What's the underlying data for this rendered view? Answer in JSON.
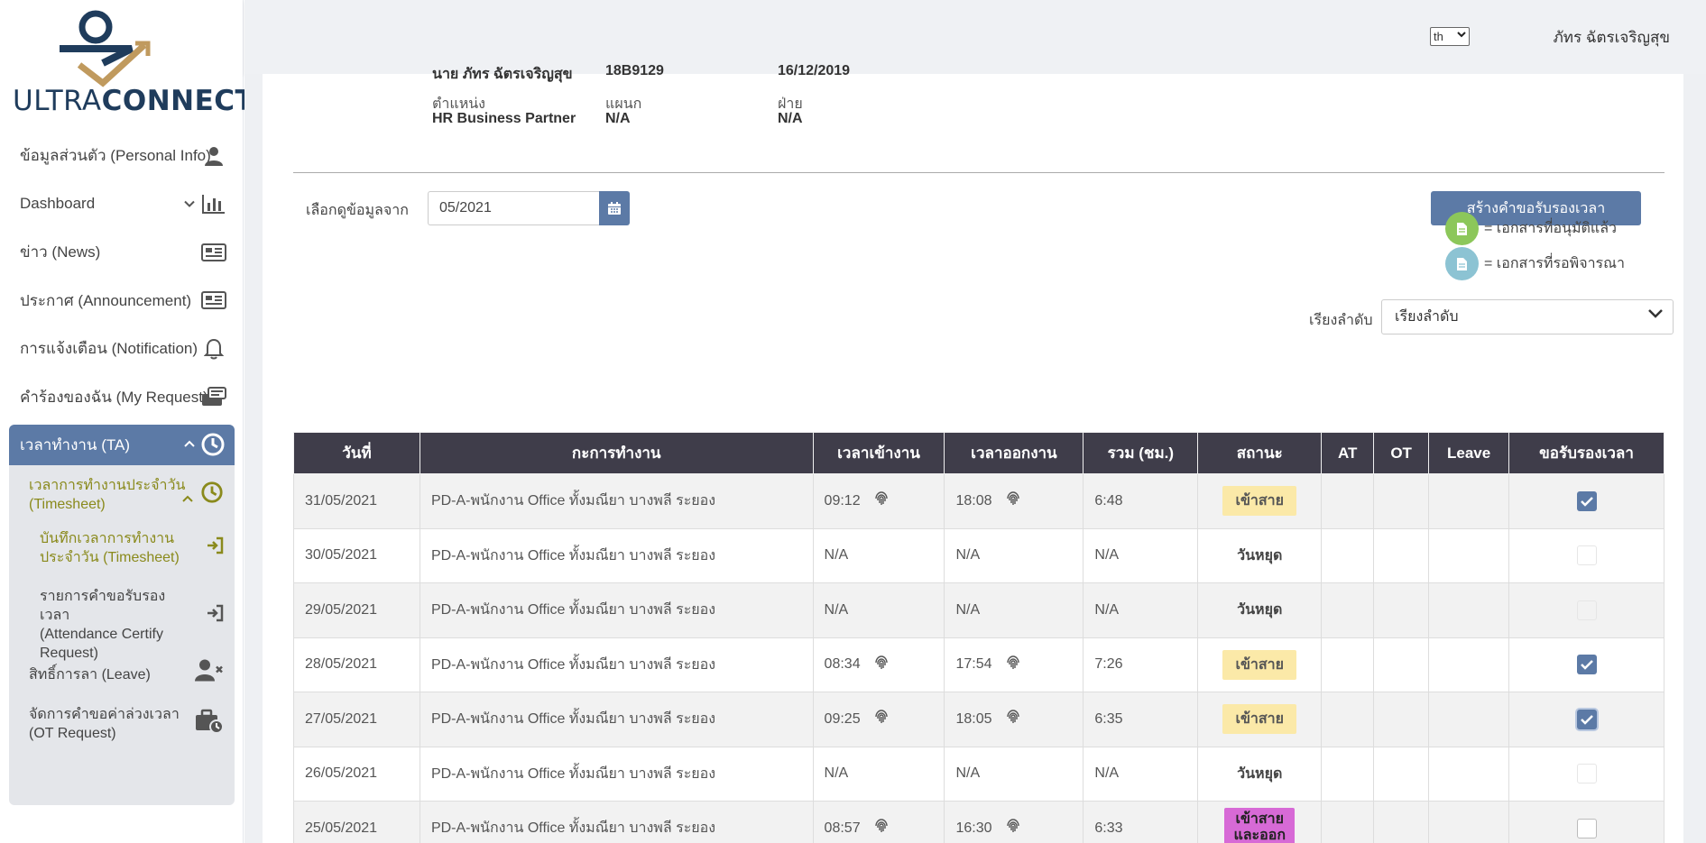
{
  "brand": {
    "logo_text_light": "ULTRA",
    "logo_text_bold": "CONNECT",
    "colors": {
      "navy": "#1f3c5c",
      "gold": "#c09a5e",
      "accent": "#5c7aa6"
    }
  },
  "header": {
    "language": "th",
    "user_name": "ภัทร ฉัตรเจริญสุข"
  },
  "sidebar": {
    "items": [
      {
        "label": "ข้อมูลส่วนตัว (Personal Info)",
        "icon": "user-icon"
      },
      {
        "label": "Dashboard",
        "icon": "bar-chart-icon"
      },
      {
        "label": "ข่าว (News)",
        "icon": "newspaper-icon"
      },
      {
        "label": "ประกาศ (Announcement)",
        "icon": "newspaper-icon"
      },
      {
        "label": "การแจ้งเตือน (Notification)",
        "icon": "bell-icon"
      },
      {
        "label": "คำร้องของฉัน (My Request)",
        "icon": "inbox-icon"
      }
    ],
    "ta": {
      "label": "เวลาทำงาน (TA)",
      "timesheet_line1": "เวลาการทำงานประจำวัน",
      "timesheet_line2": "(Timesheet)",
      "record_line1": "บันทึกเวลาการทำงาน",
      "record_line2": "ประจำวัน (Timesheet)",
      "certify_line1": "รายการคำขอรับรองเวลา",
      "certify_line2": "(Attendance Certify",
      "certify_line3": "Request)",
      "leave": "สิทธิ์การลา (Leave)",
      "ot_line1": "จัดการคำขอค่าล่วงเวลา",
      "ot_line2": "(OT Request)"
    }
  },
  "employee": {
    "name": "นาย ภัทร ฉัตรเจริญสุข",
    "code": "18B9129",
    "start_date": "16/12/2019",
    "position_label": "ตำแหน่ง",
    "position": "HR Business Partner",
    "section_label": "แผนก",
    "section": "N/A",
    "division_label": "ฝ่าย",
    "division": "N/A"
  },
  "filter": {
    "label": "เลือกดูข้อมูลจาก",
    "value": "05/2021"
  },
  "create_button": "สร้างคำขอรับรองเวลา",
  "legend": {
    "approved": "= เอกสารที่อนุมัติแล้ว",
    "pending": "= เอกสารที่รอพิจารณา"
  },
  "sort": {
    "label": "เรียงลำดับ",
    "value": "เรียงลำดับ"
  },
  "table": {
    "headers": [
      "วันที่",
      "กะการทำงาน",
      "เวลาเข้างาน",
      "เวลาออกงาน",
      "รวม (ชม.)",
      "สถานะ",
      "AT",
      "OT",
      "Leave",
      "ขอรับรองเวลา"
    ],
    "rows": [
      {
        "date": "31/05/2021",
        "shift": "PD-A-พนักงาน Office ทั้งมณียา บางพลี ระยอง",
        "in": "09:12",
        "out": "18:08",
        "total": "6:48",
        "status": "เข้าสาย"
      },
      {
        "date": "30/05/2021",
        "shift": "PD-A-พนักงาน Office ทั้งมณียา บางพลี ระยอง",
        "in": "N/A",
        "out": "N/A",
        "total": "N/A",
        "status": "วันหยุด"
      },
      {
        "date": "29/05/2021",
        "shift": "PD-A-พนักงาน Office ทั้งมณียา บางพลี ระยอง",
        "in": "N/A",
        "out": "N/A",
        "total": "N/A",
        "status": "วันหยุด"
      },
      {
        "date": "28/05/2021",
        "shift": "PD-A-พนักงาน Office ทั้งมณียา บางพลี ระยอง",
        "in": "08:34",
        "out": "17:54",
        "total": "7:26",
        "status": "เข้าสาย"
      },
      {
        "date": "27/05/2021",
        "shift": "PD-A-พนักงาน Office ทั้งมณียา บางพลี ระยอง",
        "in": "09:25",
        "out": "18:05",
        "total": "6:35",
        "status": "เข้าสาย"
      },
      {
        "date": "26/05/2021",
        "shift": "PD-A-พนักงาน Office ทั้งมณียา บางพลี ระยอง",
        "in": "N/A",
        "out": "N/A",
        "total": "N/A",
        "status": "วันหยุด"
      },
      {
        "date": "25/05/2021",
        "shift": "PD-A-พนักงาน Office ทั้งมณียา บางพลี ระยอง",
        "in": "08:57",
        "out": "16:30",
        "total": "6:33",
        "status_line1": "เข้าสาย",
        "status_line2": "และออก"
      }
    ]
  }
}
